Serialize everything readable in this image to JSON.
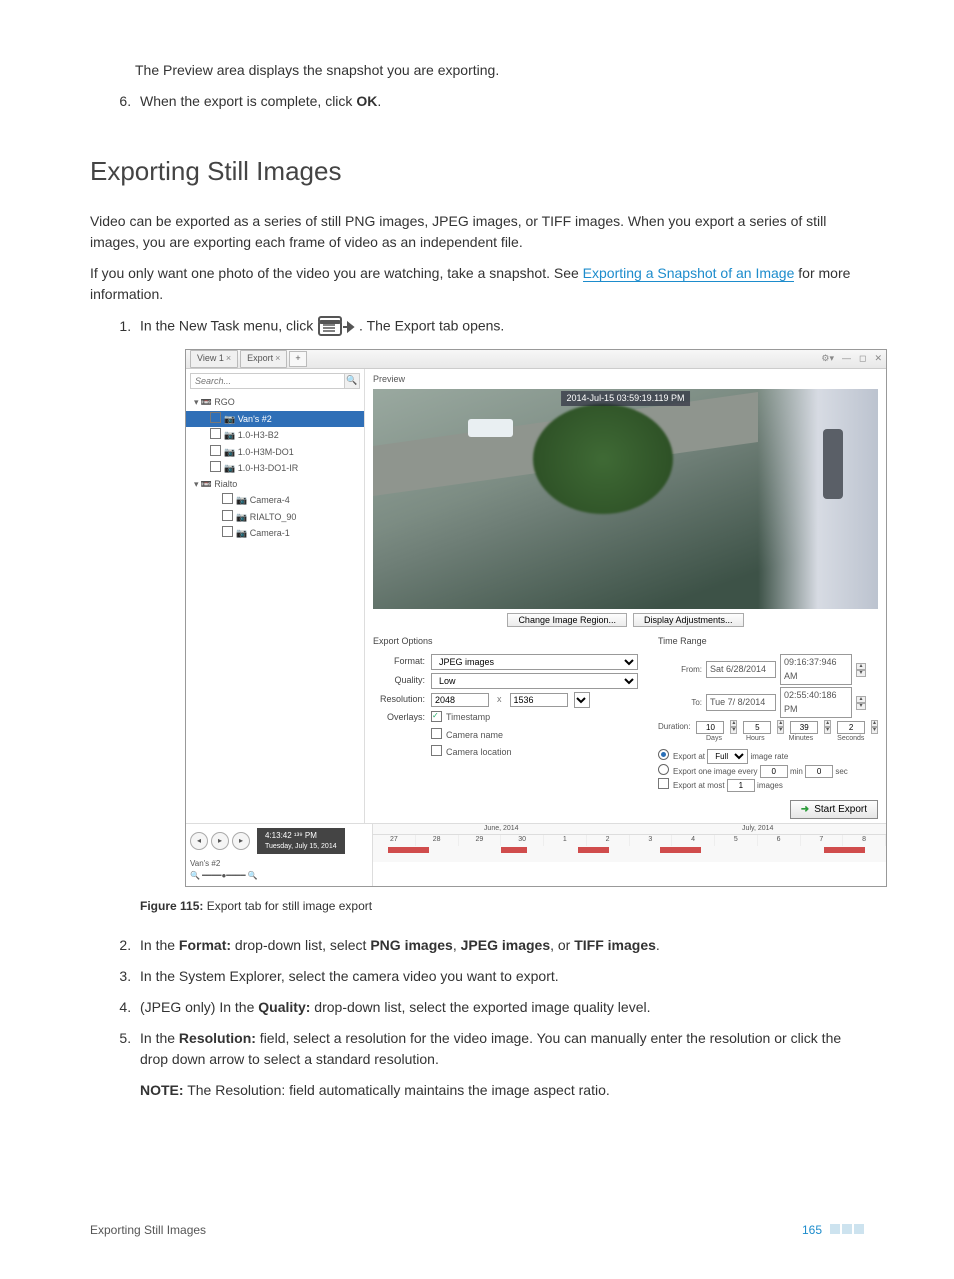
{
  "intro": {
    "preview_line": "The Preview area displays the snapshot you are exporting.",
    "step6_a": "When the export is complete, click ",
    "step6_b": "OK",
    "step6_c": "."
  },
  "heading": "Exporting Still Images",
  "para1": "Video can be exported as a series of still PNG images, JPEG images, or TIFF images. When you export a series of still images, you are exporting each frame of video as an independent file.",
  "para2_a": "If you only want one photo of the video you are watching, take a snapshot. See ",
  "para2_link": "Exporting a Snapshot of an Image",
  "para2_b": " for more information.",
  "step1_a": "In the New Task menu, click ",
  "step1_b": ". The Export tab opens.",
  "screenshot": {
    "tabs": {
      "view": "View 1",
      "export": "Export"
    },
    "search_placeholder": "Search...",
    "tree": {
      "site1": "RGO",
      "cam_selected": "Van's #2",
      "cam2": "1.0-H3-B2",
      "cam3": "1.0-H3M-DO1",
      "cam4": "1.0-H3-DO1-IR",
      "site2": "Rialto",
      "cam5": "Camera-4",
      "cam6": "RIALTO_90",
      "cam7": "Camera-1"
    },
    "preview": "Preview",
    "timestamp": "2014-Jul-15 03:59:19.119 PM",
    "btn_region": "Change Image Region...",
    "btn_adjust": "Display Adjustments...",
    "export_options": "Export Options",
    "format_lbl": "Format:",
    "format_val": "JPEG images",
    "quality_lbl": "Quality:",
    "quality_val": "Low",
    "resolution_lbl": "Resolution:",
    "res_w": "2048",
    "res_h": "1536",
    "overlays_lbl": "Overlays:",
    "ov_timestamp": "Timestamp",
    "ov_camname": "Camera name",
    "ov_camloc": "Camera location",
    "time_range": "Time Range",
    "from_lbl": "From:",
    "from_date": "Sat   6/28/2014",
    "from_time": "09:16:37:946  AM",
    "to_lbl": "To:",
    "to_date": "Tue   7/ 8/2014",
    "to_time": "02:55:40:186  PM",
    "duration_lbl": "Duration:",
    "d_days": "10",
    "d_hours": "5",
    "d_min": "39",
    "d_sec": "2",
    "lbl_days": "Days",
    "lbl_hours": "Hours",
    "lbl_min": "Minutes",
    "lbl_sec": "Seconds",
    "rate_a": "Export at ",
    "rate_sel": "Full",
    "rate_b": " image rate",
    "every_a": "Export one image every",
    "every_min": "0",
    "every_min_u": "min",
    "every_sec": "0",
    "every_sec_u": "sec",
    "atmost_a": "Export at most",
    "atmost_v": "1",
    "atmost_b": "images",
    "start": "Start Export",
    "play_time": "4:13:42 ¹³⁹ PM",
    "play_date": "Tuesday, July 15, 2014",
    "month1": "June, 2014",
    "month2": "July, 2014",
    "camera_label": "Van's #2"
  },
  "caption_a": "Figure 115: ",
  "caption_b": "Export tab for still image export",
  "step2_a": "In the ",
  "step2_b": "Format:",
  "step2_c": " drop-down list, select ",
  "step2_d": "PNG images",
  "step2_e": ", ",
  "step2_f": "JPEG images",
  "step2_g": ", or ",
  "step2_h": "TIFF images",
  "step2_i": ".",
  "step3": "In the System Explorer, select the camera video you want to export.",
  "step4_a": "(JPEG only) In the ",
  "step4_b": "Quality:",
  "step4_c": " drop-down list, select the exported image quality level.",
  "step5_a": "In the ",
  "step5_b": "Resolution:",
  "step5_c": " field, select a resolution for the video image. You can manually enter the resolution or click the drop down arrow to select a standard resolution.",
  "note_a": "NOTE:",
  "note_b": " The Resolution: field automatically maintains the image aspect ratio.",
  "footer_title": "Exporting Still Images",
  "page_num": "165"
}
